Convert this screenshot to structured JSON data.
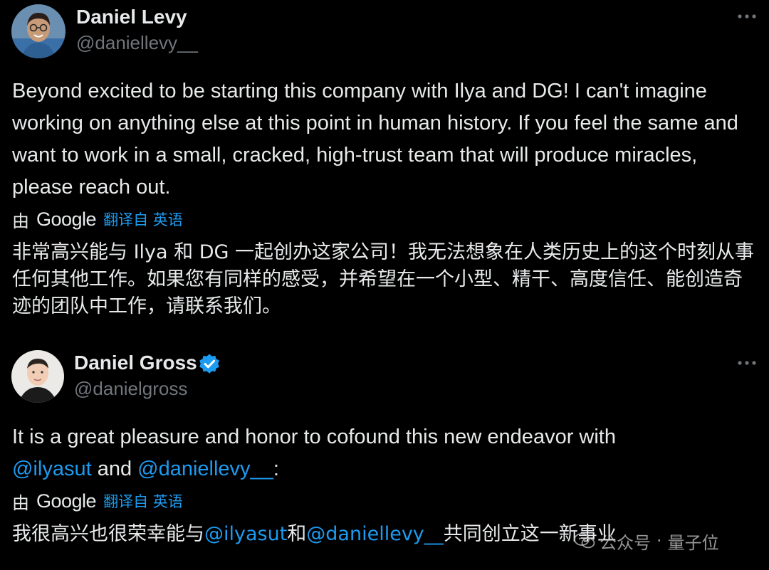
{
  "tweets": [
    {
      "display_name": "Daniel Levy",
      "handle": "@daniellevy__",
      "verified": false,
      "text": "Beyond excited to be starting this company with Ilya and DG! I can't imagine working on anything else at this point in human history. If you feel the same and want to work in a small, cracked, high-trust team that will produce miracles, please reach out.",
      "translate_prefix": "由",
      "translate_provider": "Google",
      "translate_link": "翻译自 英语",
      "translated_text": "非常高兴能与 Ilya 和 DG 一起创办这家公司！我无法想象在人类历史上的这个时刻从事任何其他工作。如果您有同样的感受，并希望在一个小型、精干、高度信任、能创造奇迹的团队中工作，请联系我们。"
    },
    {
      "display_name": "Daniel Gross",
      "handle": "@danielgross",
      "verified": true,
      "text_part1": "It is a great pleasure and honor to cofound this new endeavor with",
      "mention1": "@ilyasut",
      "text_and": " and ",
      "mention2": "@daniellevy__",
      "text_colon": ":",
      "translate_prefix": "由",
      "translate_provider": "Google",
      "translate_link": "翻译自 英语",
      "translated_part1": "我很高兴也很荣幸能与",
      "translated_mention1": "@ilyasut",
      "translated_and": "和",
      "translated_mention2": "@daniellevy__",
      "translated_part2": "共同创立这一新事业"
    }
  ],
  "watermark": {
    "icon": "wechat-icon",
    "text1": "公众号",
    "sep": "·",
    "text2": "量子位"
  },
  "colors": {
    "background": "#000000",
    "text": "#e7e9ea",
    "secondary": "#71767b",
    "link": "#1d9bf0"
  }
}
